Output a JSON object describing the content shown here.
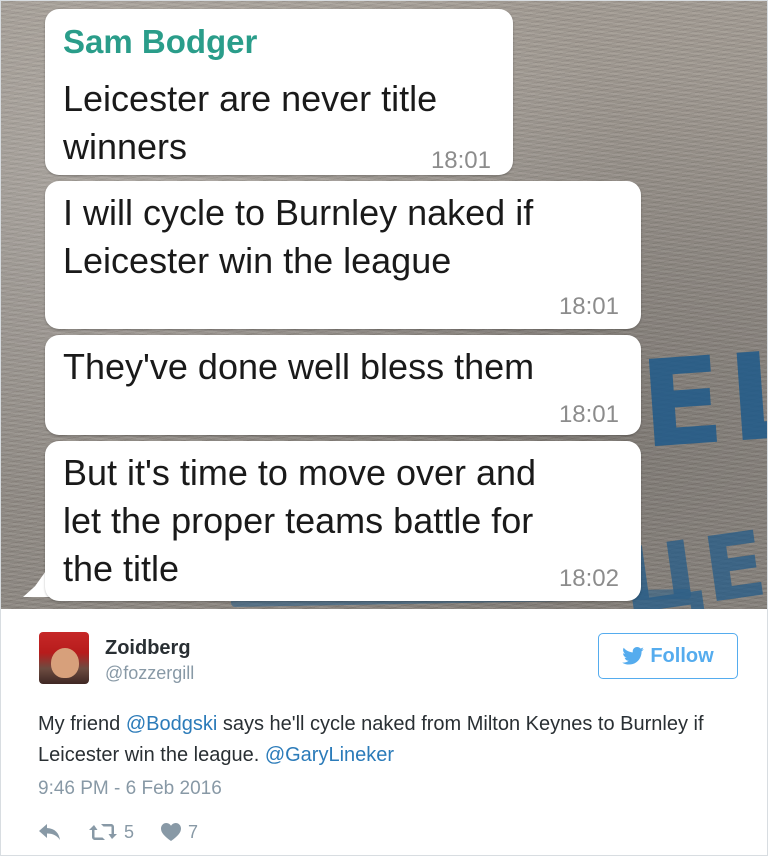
{
  "chat": {
    "messages": [
      {
        "sender": "Sam Bodger",
        "text": "Leicester are never title winners",
        "time": "18:01"
      },
      {
        "text": "I will cycle to Burnley naked if Leicester win the league",
        "time": "18:01"
      },
      {
        "text": "They've done well bless them",
        "time": "18:01"
      },
      {
        "text": "But it's time to move over and let the proper teams battle for the title",
        "time": "18:02"
      }
    ]
  },
  "tweet": {
    "author_name": "Zoidberg",
    "author_handle": "@fozzergill",
    "follow_label": "Follow",
    "text_parts": [
      "My friend ",
      "@Bodgski",
      " says he'll cycle naked from Milton Keynes to Burnley if Leicester win the league. ",
      "@GaryLineker"
    ],
    "timestamp": "9:46 PM - 6 Feb 2016",
    "retweets": "5",
    "likes": "7",
    "icons": {
      "reply": "reply-icon",
      "retweet": "retweet-icon",
      "like": "heart-icon",
      "follow": "twitter-bird-icon"
    },
    "colors": {
      "accent": "#55acee",
      "link": "#2b7bb9",
      "muted": "#8899a6"
    }
  }
}
